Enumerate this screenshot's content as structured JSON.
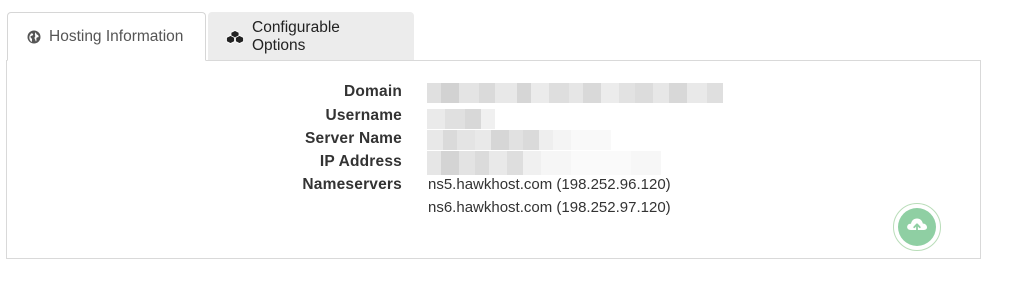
{
  "tabs": [
    {
      "label": "Hosting Information",
      "icon": "globe-icon",
      "active": true
    },
    {
      "label": "Configurable Options",
      "icon": "cubes-icon",
      "active": false
    }
  ],
  "details": {
    "domain_label": "Domain",
    "username_label": "Username",
    "server_name_label": "Server Name",
    "ip_address_label": "IP Address",
    "nameservers_label": "Nameservers",
    "nameservers": [
      "ns5.hawkhost.com (198.252.96.120)",
      "ns6.hawkhost.com (198.252.97.120)"
    ]
  },
  "floating_button": {
    "icon": "cloud-upload-icon",
    "color": "#8fcfa3"
  }
}
